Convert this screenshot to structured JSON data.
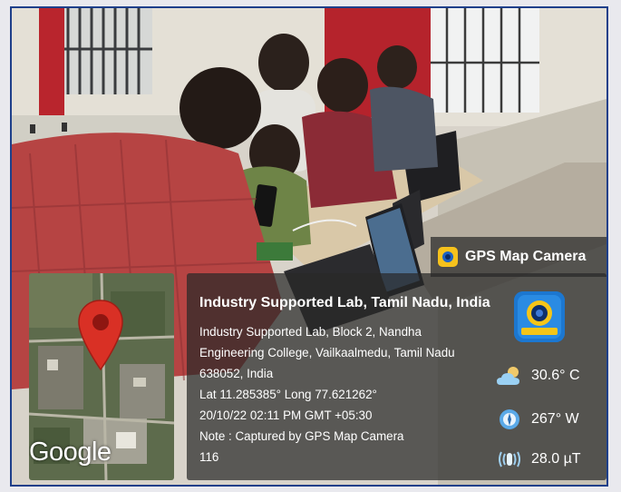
{
  "header": {
    "app_name": "GPS Map Camera"
  },
  "map": {
    "attribution": "Google"
  },
  "location": {
    "title": "Industry Supported Lab, Tamil Nadu, India",
    "address_line_1": "Industry Supported Lab, Block 2, Nandha",
    "address_line_2": "Engineering College, Vailkaalmedu, Tamil Nadu",
    "address_line_3": "638052, India",
    "coordinates": "Lat 11.285385° Long 77.621262°",
    "datetime": "20/10/22 02:11 PM GMT +05:30",
    "note": "Note : Captured by GPS Map Camera",
    "note_extra": "116"
  },
  "metrics": {
    "temperature": "30.6° C",
    "wind": "267° W",
    "magnetic_field": "28.0 µT"
  },
  "icons": {
    "header_logo": "gps-map-camera-logo-icon",
    "pin": "map-pin-icon",
    "weather": "cloud-sun-icon",
    "compass": "compass-icon",
    "magnet": "magnetic-field-icon"
  },
  "colors": {
    "frame_border": "#1e3f8a",
    "pin": "#d93025",
    "overlay": "rgba(40,40,40,0.72)"
  }
}
